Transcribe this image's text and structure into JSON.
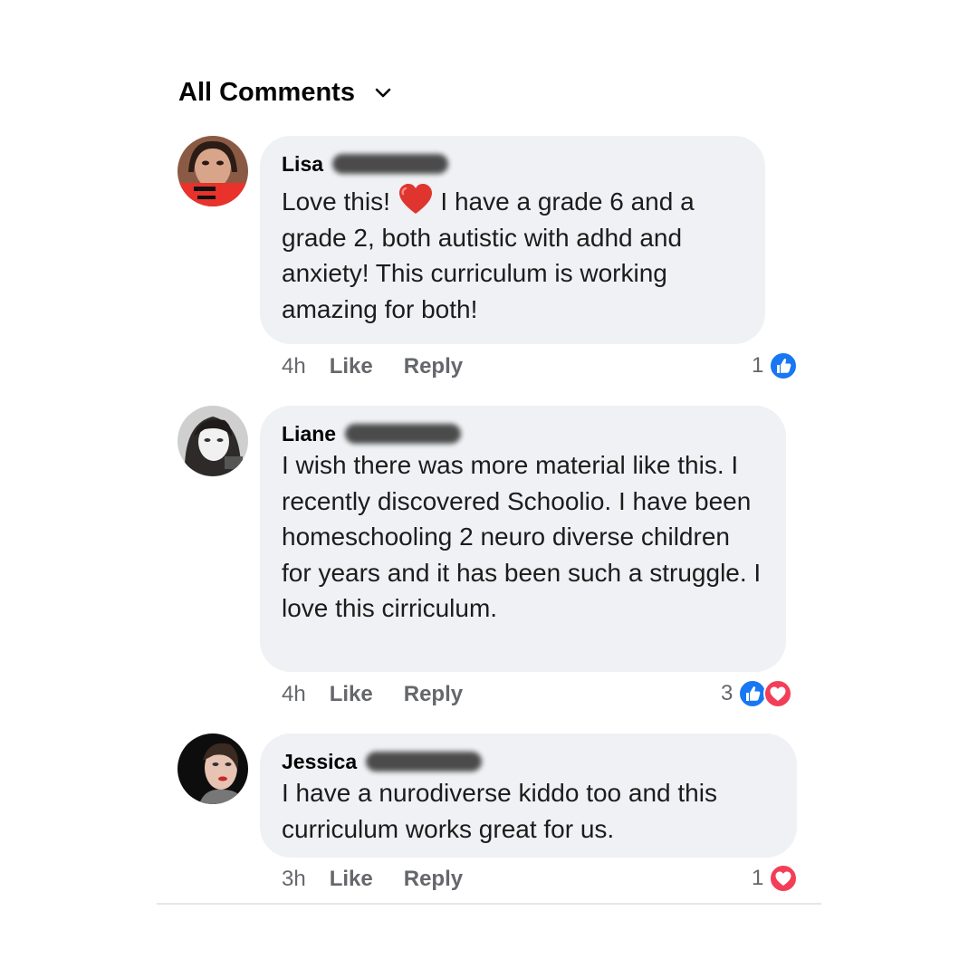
{
  "header": {
    "title": "All Comments",
    "dropdown_icon": "chevron-down-icon"
  },
  "comments": [
    {
      "name": "Lisa",
      "text_before_emoji": "Love this! ",
      "emoji": "red-heart-emoji",
      "text_after_emoji": " I have a grade 6 and a grade 2, both autistic with adhd and anxiety! This curriculum is working amazing for both!",
      "time": "4h",
      "like_label": "Like",
      "reply_label": "Reply",
      "reaction_count": "1",
      "reactions": [
        "like"
      ]
    },
    {
      "name": "Liane",
      "text": "I wish there was more material like this.  I recently discovered Schoolio.  I have been homeschooling 2 neuro diverse children for years and it has been such a struggle.  I love this cirriculum.",
      "time": "4h",
      "like_label": "Like",
      "reply_label": "Reply",
      "reaction_count": "3",
      "reactions": [
        "like",
        "love"
      ]
    },
    {
      "name": "Jessica",
      "text": "I have a nurodiverse kiddo too and this curriculum works great for us.",
      "time": "3h",
      "like_label": "Like",
      "reply_label": "Reply",
      "reaction_count": "1",
      "reactions": [
        "love"
      ]
    }
  ],
  "colors": {
    "like_blue": "#1877f2",
    "love_red": "#f33e58",
    "bubble": "#eff1f4",
    "meta": "#65676b"
  }
}
